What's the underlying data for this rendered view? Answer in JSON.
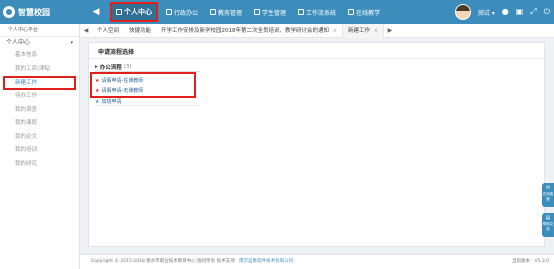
{
  "brand": {
    "name": "智慧校园"
  },
  "topnav": {
    "back_icon": "arrow-left-icon",
    "items": [
      {
        "label": "个人中心",
        "icon": "grid-icon",
        "active": true
      },
      {
        "label": "行政办公",
        "icon": "grid-icon"
      },
      {
        "label": "教务管理",
        "icon": "grid-icon"
      },
      {
        "label": "学生管理",
        "icon": "grid-icon"
      },
      {
        "label": "工作流系统",
        "icon": "grid-icon"
      },
      {
        "label": "在线教学",
        "icon": "grid-icon"
      }
    ],
    "user_name": "测试",
    "user_caret": "▾",
    "right_icons": [
      "bell-icon",
      "monitor-icon",
      "expand-icon",
      "power-icon"
    ]
  },
  "sidebar": {
    "header": "个人中心平台",
    "group": {
      "label": "个人中心",
      "caret": "▾"
    },
    "items": [
      "基本信息",
      "我的工资/津贴",
      "新建工作",
      "待办工作",
      "我的调查",
      "我的课题",
      "我的论文",
      "我的培训",
      "我的研究"
    ],
    "active_index": 2
  },
  "tabs": {
    "left_arrow": "◀",
    "items": [
      "个人空间",
      "快捷功能",
      "开学工作安排及新学校园2018年第二次全员培训、教学研讨会的通知",
      "新建工作"
    ],
    "close_mark": "×",
    "right_arrow": "▶",
    "current_index": 3
  },
  "panel": {
    "title": "申请流程选择",
    "category": {
      "label": "办公流程",
      "count": "(3)"
    },
    "flows": [
      {
        "label": "请假申请-任课教师",
        "highlighted": true
      },
      {
        "label": "请假申请-无课教师",
        "highlighted": true
      },
      {
        "label": "加班申请",
        "highlighted": false
      }
    ]
  },
  "footer": {
    "copyright": "Copyright © 2015-2018  衡水市职业技术教育中心 版权所有  技术支持：",
    "tech_support": "南京蓝象软件技术有限公司",
    "version": "当前版本：V5.3.0"
  },
  "float_buttons": [
    {
      "icon": "chat-icon",
      "label": "在线客服"
    },
    {
      "icon": "doc-icon",
      "label": "帮助文档"
    }
  ],
  "colors": {
    "primary": "#3c8dbc",
    "highlight_border": "#e0201a"
  }
}
